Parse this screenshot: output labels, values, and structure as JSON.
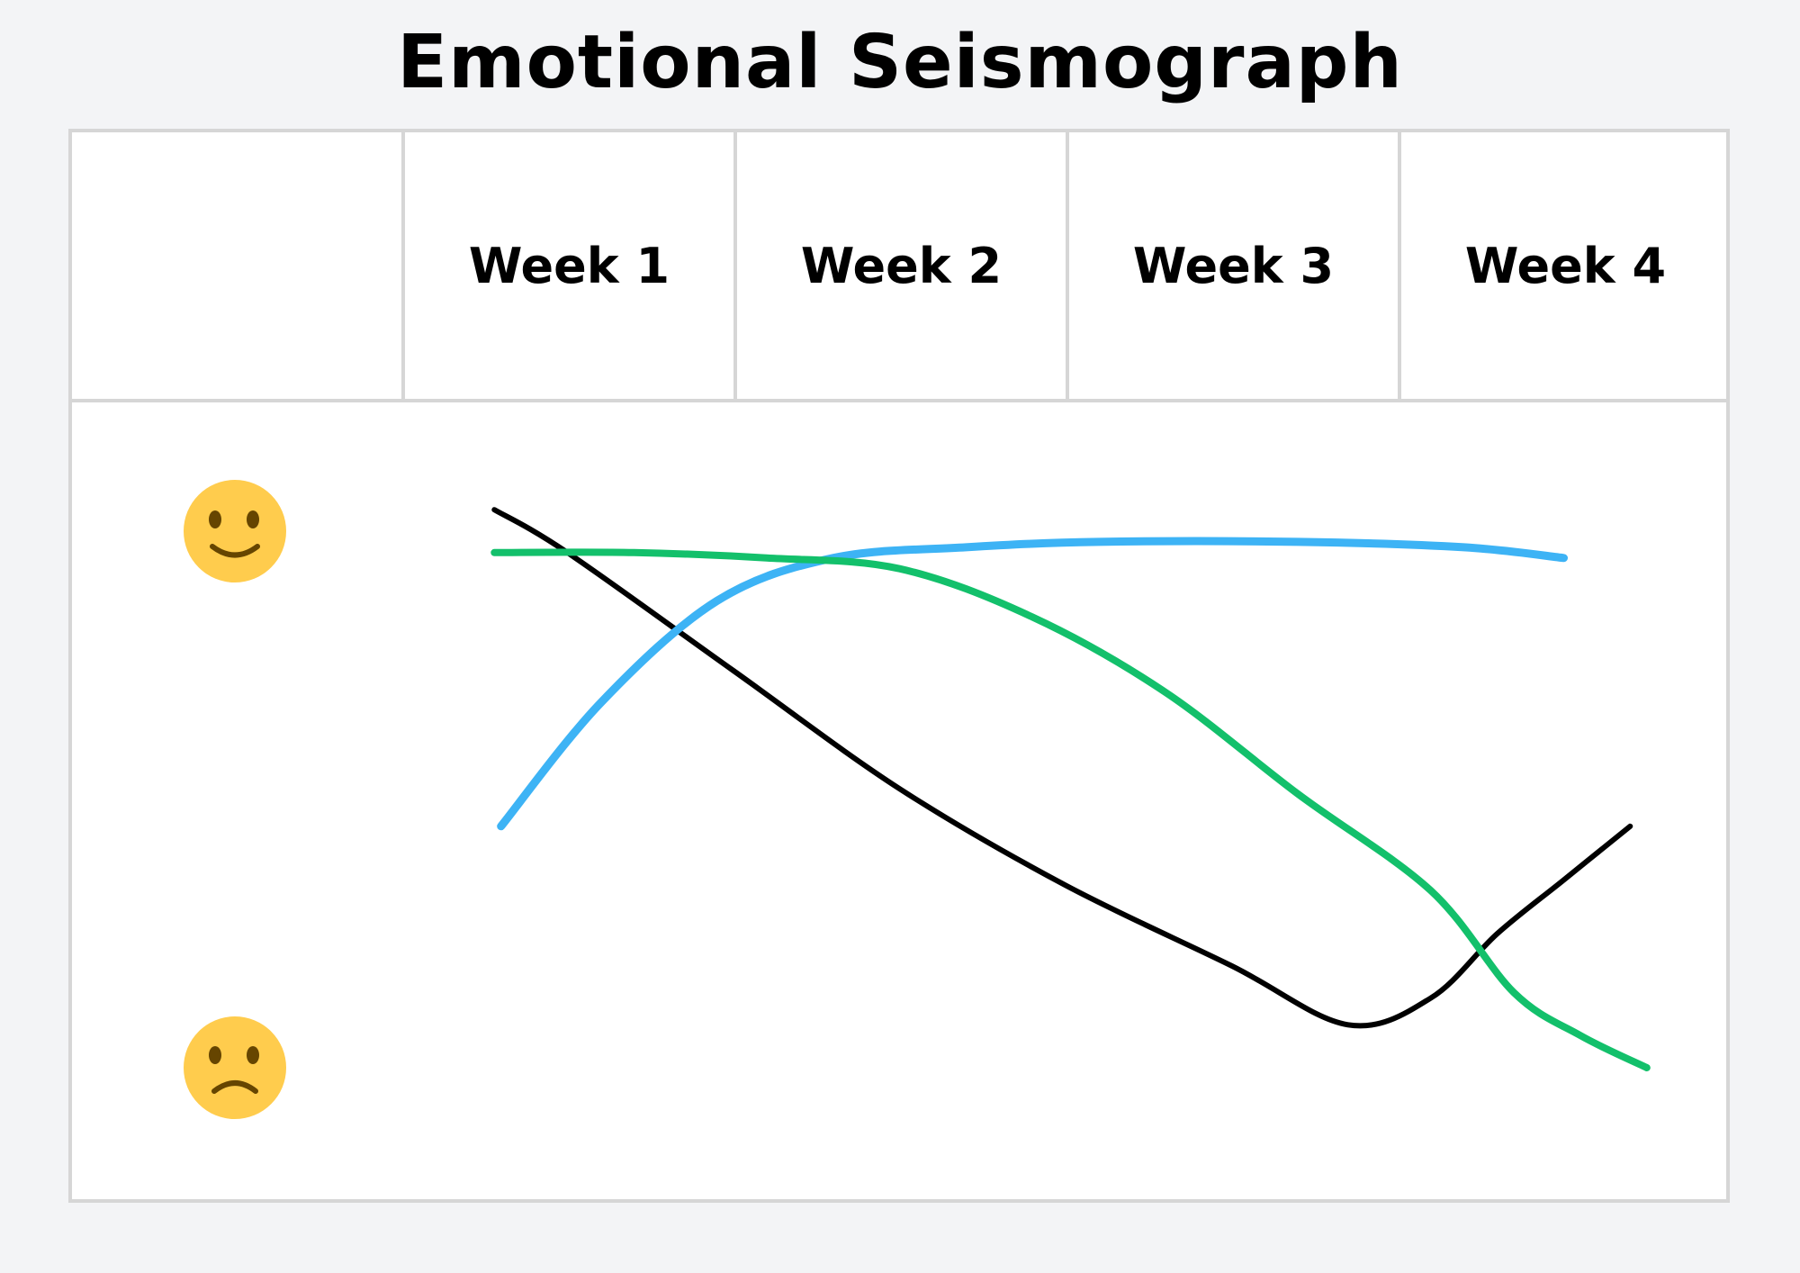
{
  "title": "Emotional Seismograph",
  "chart_data": {
    "type": "line",
    "title": "Emotional Seismograph",
    "categories": [
      "Week 1",
      "Week 2",
      "Week 3",
      "Week 4"
    ],
    "y_axis": {
      "icons": [
        {
          "icon": "smiling-face-icon",
          "meaning": "happy",
          "value": 1.0
        },
        {
          "icon": "frowning-face-icon",
          "meaning": "sad",
          "value": 0.0
        }
      ],
      "ylim": [
        0,
        1
      ]
    },
    "grid": false,
    "series": [
      {
        "color": "#000000",
        "x": [
          0.28,
          0.5,
          1.0,
          1.5,
          2.0,
          2.5,
          2.85,
          3.1,
          3.3,
          3.5,
          3.7
        ],
        "y": [
          1.04,
          0.96,
          0.74,
          0.52,
          0.34,
          0.19,
          0.08,
          0.13,
          0.25,
          0.35,
          0.45
        ]
      },
      {
        "color": "#3db3f5",
        "x": [
          0.3,
          0.6,
          0.95,
          1.3,
          1.7,
          2.1,
          2.7,
          3.2,
          3.5
        ],
        "y": [
          0.45,
          0.68,
          0.87,
          0.95,
          0.97,
          0.98,
          0.98,
          0.97,
          0.95
        ]
      },
      {
        "color": "#13c06b",
        "x": [
          0.28,
          0.7,
          1.1,
          1.5,
          1.9,
          2.3,
          2.7,
          3.1,
          3.35,
          3.55,
          3.75
        ],
        "y": [
          0.96,
          0.96,
          0.95,
          0.93,
          0.84,
          0.7,
          0.51,
          0.33,
          0.14,
          0.06,
          0.0
        ]
      }
    ]
  }
}
